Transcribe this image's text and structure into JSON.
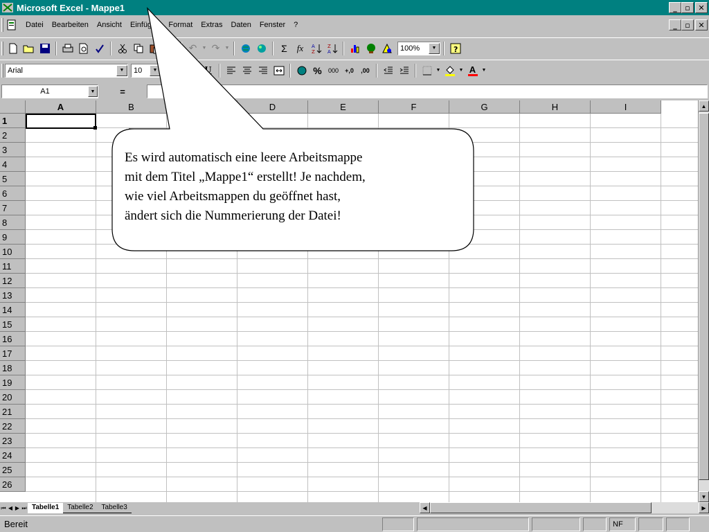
{
  "window": {
    "title": "Microsoft Excel - Mappe1"
  },
  "menu": {
    "items": [
      {
        "label": "Datei"
      },
      {
        "label": "Bearbeiten"
      },
      {
        "label": "Ansicht"
      },
      {
        "label": "Einfügen"
      },
      {
        "label": "Format"
      },
      {
        "label": "Extras"
      },
      {
        "label": "Daten"
      },
      {
        "label": "Fenster"
      },
      {
        "label": "?"
      }
    ]
  },
  "toolbar": {
    "zoom": "100%",
    "sum_symbol": "Σ",
    "function_symbol": "fx",
    "percent_symbol": "%",
    "thousands_symbol": "000",
    "inc_decimal": "+,0",
    "dec_decimal": ",00",
    "bold": "F",
    "italic": "K",
    "underline": "U",
    "font_color_letter": "A"
  },
  "format": {
    "font_name": "Arial",
    "font_size": "10"
  },
  "formula_bar": {
    "name_box": "A1",
    "equals": "="
  },
  "grid": {
    "columns": [
      "A",
      "B",
      "C",
      "D",
      "E",
      "F",
      "G",
      "H",
      "I"
    ],
    "rows": [
      "1",
      "2",
      "3",
      "4",
      "5",
      "6",
      "7",
      "8",
      "9",
      "10",
      "11",
      "12",
      "13",
      "14",
      "15",
      "16",
      "17",
      "18",
      "19",
      "20",
      "21",
      "22",
      "23",
      "24",
      "25",
      "26"
    ],
    "active_cell": "A1"
  },
  "sheets": [
    {
      "label": "Tabelle1",
      "active": true
    },
    {
      "label": "Tabelle2",
      "active": false
    },
    {
      "label": "Tabelle3",
      "active": false
    }
  ],
  "status": {
    "text": "Bereit",
    "nf": "NF"
  },
  "callout": {
    "lines": [
      "Es wird automatisch eine leere Arbeitsmappe",
      "mit dem Titel „Mappe1“ erstellt! Je nachdem,",
      "wie viel Arbeitsmappen du geöffnet hast,",
      "ändert sich die Nummerierung der Datei!"
    ]
  },
  "colors": {
    "titlebar": "#008080",
    "chrome": "#c0c0c0",
    "gridline": "#c0c0c0"
  }
}
